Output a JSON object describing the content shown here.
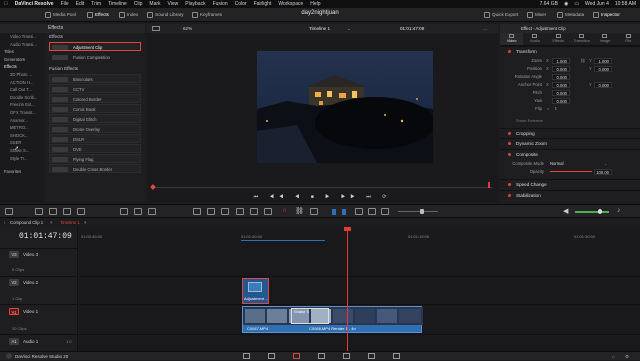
{
  "menubar": {
    "app": "DaVinci Resolve",
    "items": [
      "File",
      "Edit",
      "Trim",
      "Timeline",
      "Clip",
      "Mark",
      "View",
      "Playback",
      "Fusion",
      "Color",
      "Fairlight",
      "Workspace",
      "Help"
    ],
    "status": [
      "7.64 GB",
      "Wed Jun 4",
      "10:58 AM"
    ]
  },
  "toolbar": {
    "media_pool": "Media Pool",
    "effects": "Effects",
    "index": "Index",
    "sound_library": "Sound Library",
    "keyframes": "Keyframes",
    "quick_export": "Quick Export",
    "mixer": "Mixer",
    "metadata": "Metadata",
    "inspector": "Inspector",
    "project_title": "day2nightjuan"
  },
  "effects_panel": {
    "title": "Effects",
    "tree": [
      {
        "label": "Video Transi...",
        "level": "sub"
      },
      {
        "label": "Audio Transi...",
        "level": "sub"
      },
      {
        "label": "Titles",
        "level": "sub"
      },
      {
        "label": "Generators",
        "level": "sub"
      },
      {
        "label": "Effects",
        "level": "top"
      },
      {
        "label": "3D Photo ...",
        "level": "sub"
      },
      {
        "label": "ACTION H...",
        "level": "sub"
      },
      {
        "label": "Call Out T...",
        "level": "sub"
      },
      {
        "label": "Doodle Scrib...",
        "level": "sub"
      },
      {
        "label": "Freezin Ext...",
        "level": "sub"
      },
      {
        "label": "GFX Transit...",
        "level": "sub"
      },
      {
        "label": "Anamor...",
        "level": "sub"
      },
      {
        "label": "METRO...",
        "level": "sub"
      },
      {
        "label": "SHOCK...",
        "level": "sub"
      },
      {
        "label": "SSER",
        "level": "sub"
      },
      {
        "label": "Shake S...",
        "level": "sub"
      },
      {
        "label": "Style Tr...",
        "level": "sub"
      }
    ],
    "favorites": "Favorites",
    "group1": "Effects",
    "group1_items": [
      "Adjustment Clip",
      "Fusion Composition"
    ],
    "group2": "Fusion Effects",
    "group2_items": [
      "Binoculars",
      "CCTV",
      "Colored Border",
      "Comic Book",
      "Digital Glitch",
      "Drone Overlay",
      "DSLR",
      "DVE",
      "Flying Flag",
      "Double Cross Border"
    ]
  },
  "viewer": {
    "zoom": "62%",
    "timeline_name": "Timeline 1",
    "timecode": "01:01:47:09",
    "transport": [
      "⏮",
      "◀◀",
      "◀",
      "■",
      "▶",
      "▶▶",
      "⏭",
      "⟳"
    ]
  },
  "inspector": {
    "title": "Effect - Adjustment Clip",
    "tabs": [
      "Video",
      "Audio",
      "Effects",
      "Transition",
      "Image",
      "File"
    ],
    "transform": "Transform",
    "props": [
      {
        "label": "Zoom",
        "x": "1.000",
        "y": "1.000"
      },
      {
        "label": "Position",
        "x": "0.000",
        "y": "0.000"
      },
      {
        "label": "Rotation Angle",
        "x": "0.000"
      },
      {
        "label": "Anchor Point",
        "x": "0.000",
        "y": "0.000"
      },
      {
        "label": "Pitch",
        "x": "0.000"
      },
      {
        "label": "Yaw",
        "x": "0.000"
      },
      {
        "label": "Flip",
        "x": ""
      }
    ],
    "smart_reframe": "Smart Reframe",
    "cropping": "Cropping",
    "dynamic_zoom": "Dynamic Zoom",
    "composite": "Composite",
    "composite_mode_label": "Composite Mode",
    "composite_mode": "Normal",
    "opacity_label": "Opacity",
    "opacity": "100.00",
    "speed_change": "Speed Change",
    "stabilization": "Stabilization"
  },
  "timeline": {
    "tabs": [
      "Compound Clip 1",
      "Timeline 1"
    ],
    "timecode": "01:01:47:09",
    "ruler": [
      "01:00:45:00",
      "01:01:00:00",
      "01:01:15:00",
      "01:01:30:00"
    ],
    "tracks": [
      {
        "id": "V3",
        "name": "Video 3",
        "clips": "0 Clips"
      },
      {
        "id": "V2",
        "name": "Video 2",
        "clips": "1 Clip"
      },
      {
        "id": "V1",
        "name": "Video 1",
        "clips": "20 Clips"
      },
      {
        "id": "A1",
        "name": "Audio 1",
        "clips": "1.0"
      }
    ],
    "adjustment_clip": "Adjustment ...",
    "clip_a": "C0067.MP4",
    "clip_b": "C0068.MP4 Render 1 - 4n",
    "fx_label": "Shake S"
  },
  "statusbar": {
    "app_version": "DaVinci Resolve Studio 20"
  },
  "colors": {
    "accent_red": "#e0473e",
    "playhead": "#e53935",
    "clip_blue": "#2f6fb3"
  }
}
